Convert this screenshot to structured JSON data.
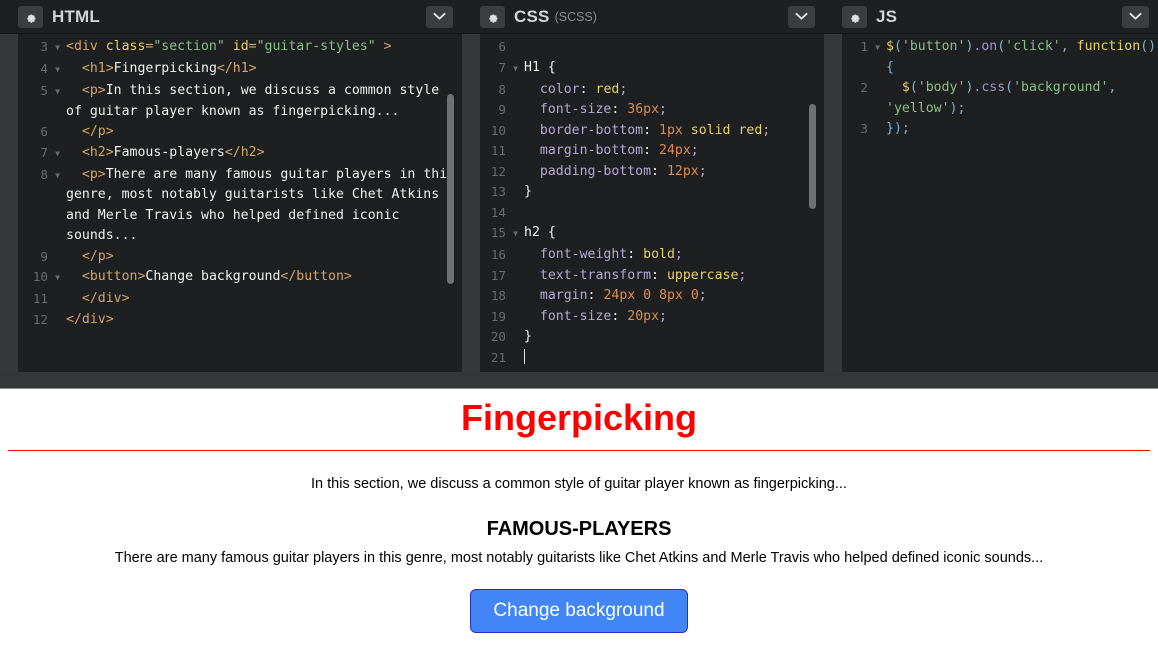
{
  "panels": [
    {
      "key": "html",
      "title": "HTML",
      "subtitle": "",
      "gear_icon": "gear-icon",
      "chevron_icon": "chevron-down-icon"
    },
    {
      "key": "css",
      "title": "CSS",
      "subtitle": "(SCSS)",
      "gear_icon": "gear-icon",
      "chevron_icon": "chevron-down-icon"
    },
    {
      "key": "js",
      "title": "JS",
      "subtitle": "",
      "gear_icon": "gear-icon",
      "chevron_icon": "chevron-down-icon"
    }
  ],
  "html_editor": {
    "lines": [
      {
        "num": "3",
        "fold": true,
        "text": "<div class=\"section\" id=\"guitar-styles\" >"
      },
      {
        "num": "4",
        "fold": true,
        "text": "  <h1>Fingerpicking</h1>"
      },
      {
        "num": "5",
        "fold": true,
        "text": "  <p>In this section, we discuss a common style of guitar player known as fingerpicking..."
      },
      {
        "num": "6",
        "fold": false,
        "text": "  </p>"
      },
      {
        "num": "7",
        "fold": true,
        "text": "  <h2>Famous-players</h2>"
      },
      {
        "num": "8",
        "fold": true,
        "text": "  <p>There are many famous guitar players in this genre, most notably guitarists like Chet Atkins and Merle Travis who helped defined iconic sounds..."
      },
      {
        "num": "9",
        "fold": false,
        "text": "  </p>"
      },
      {
        "num": "10",
        "fold": true,
        "text": "  <button>Change background</button>"
      },
      {
        "num": "11",
        "fold": false,
        "text": "  </div>"
      },
      {
        "num": "12",
        "fold": false,
        "text": "</div>"
      }
    ]
  },
  "css_editor": {
    "lines": [
      {
        "num": "6",
        "fold": false,
        "text": ""
      },
      {
        "num": "7",
        "fold": true,
        "text": "H1 {"
      },
      {
        "num": "8",
        "fold": false,
        "text": "  color: red;"
      },
      {
        "num": "9",
        "fold": false,
        "text": "  font-size: 36px;"
      },
      {
        "num": "10",
        "fold": false,
        "text": "  border-bottom: 1px solid red;"
      },
      {
        "num": "11",
        "fold": false,
        "text": "  margin-bottom: 24px;"
      },
      {
        "num": "12",
        "fold": false,
        "text": "  padding-bottom: 12px;"
      },
      {
        "num": "13",
        "fold": false,
        "text": "}"
      },
      {
        "num": "14",
        "fold": false,
        "text": ""
      },
      {
        "num": "15",
        "fold": true,
        "text": "h2 {"
      },
      {
        "num": "16",
        "fold": false,
        "text": "  font-weight: bold;"
      },
      {
        "num": "17",
        "fold": false,
        "text": "  text-transform: uppercase;"
      },
      {
        "num": "18",
        "fold": false,
        "text": "  margin: 24px 0 8px 0;"
      },
      {
        "num": "19",
        "fold": false,
        "text": "  font-size: 20px;"
      },
      {
        "num": "20",
        "fold": false,
        "text": "}"
      },
      {
        "num": "21",
        "fold": false,
        "text": ""
      }
    ]
  },
  "js_editor": {
    "lines": [
      {
        "num": "1",
        "fold": true,
        "text": "$('button').on('click', function() {"
      },
      {
        "num": "2",
        "fold": false,
        "text": "  $('body').css('background', 'yellow');"
      },
      {
        "num": "3",
        "fold": false,
        "text": "});"
      }
    ]
  },
  "preview": {
    "h1": "Fingerpicking",
    "p1": "In this section, we discuss a common style of guitar player known as fingerpicking...",
    "h2": "Famous-players",
    "p2": "There are many famous guitar players in this genre, most notably guitarists like Chet Atkins and Merle Travis who helped defined iconic sounds...",
    "button_label": "Change background"
  },
  "colors": {
    "editor_bg": "#1d1f20",
    "header_bg": "#1d1f20",
    "rail": "#353739",
    "splitbar": "#343638",
    "h1_red": "#ff0000",
    "button_blue": "#4285f4",
    "button_border": "#2b2bd0",
    "tag": "#d3a76a",
    "attr": "#e6d36a",
    "string": "#8bbf8b",
    "property": "#b8a8d8",
    "number": "#e08b4a",
    "method": "#a590d8"
  }
}
